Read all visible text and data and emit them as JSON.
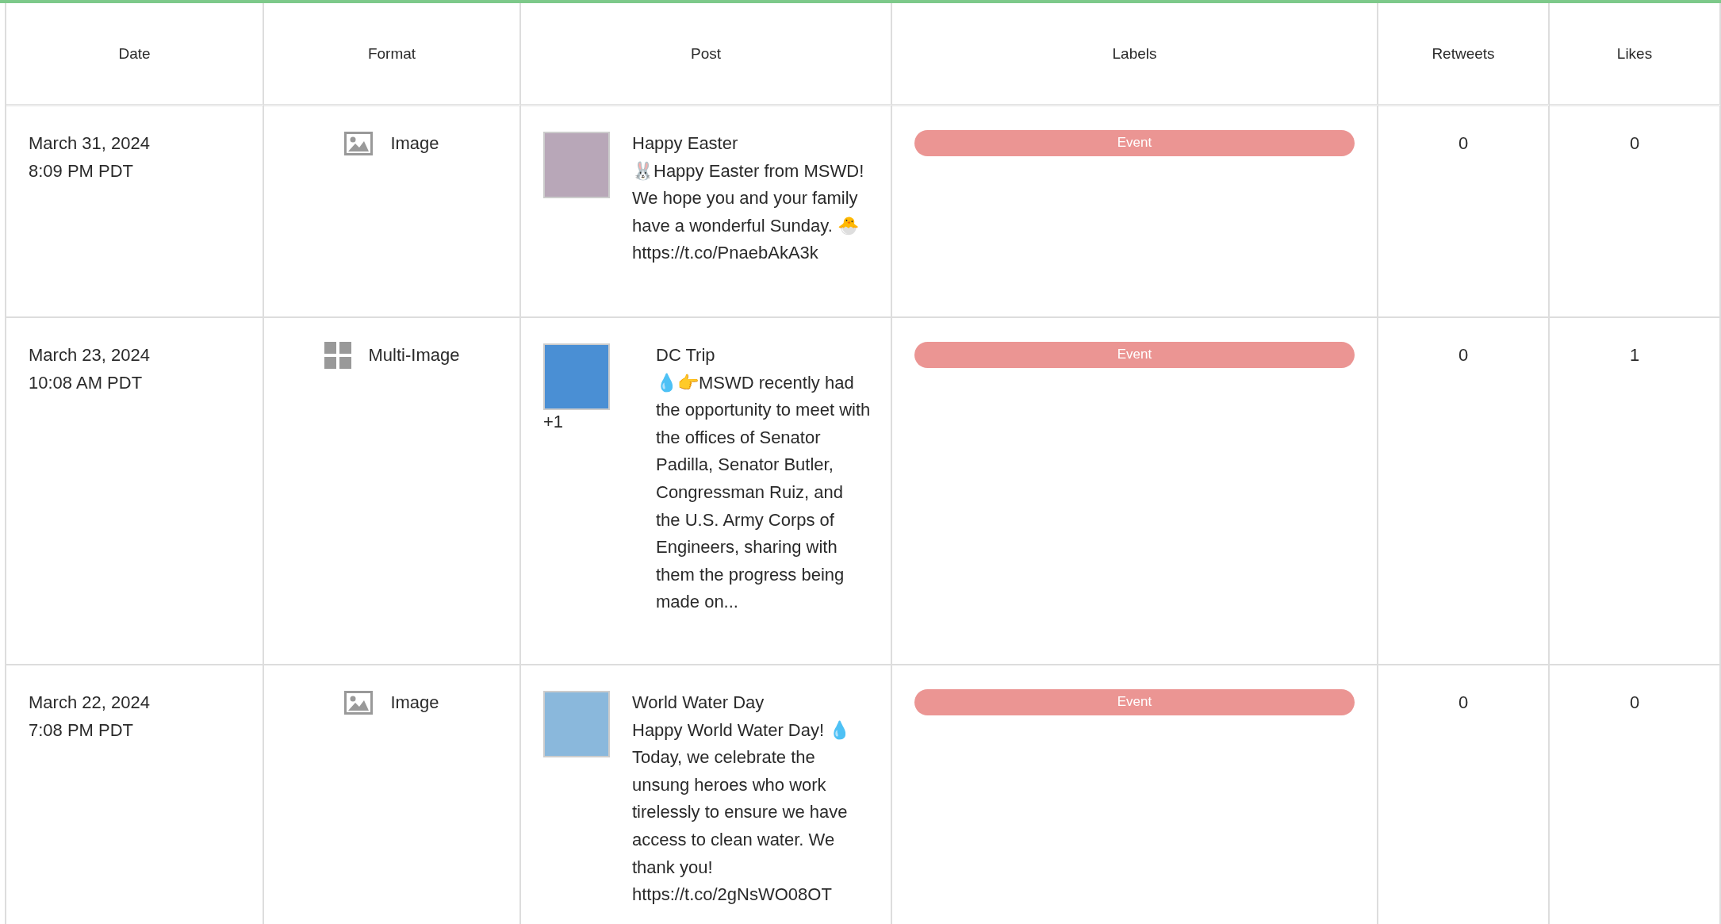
{
  "columns": [
    "Date",
    "Format",
    "Post",
    "Labels",
    "Retweets",
    "Likes"
  ],
  "rows": [
    {
      "date": "March 31, 2024",
      "time": "8:09 PM PDT",
      "format": {
        "kind": "image",
        "label": "Image"
      },
      "post": {
        "title": "Happy Easter",
        "body": "🐰Happy Easter from MSWD! We hope you and your family have a wonderful Sunday. 🐣 https://t.co/PnaebAkA3k"
      },
      "labels": [
        {
          "text": "Event",
          "color": "#eb9593"
        }
      ],
      "retweets": "0",
      "likes": "0"
    },
    {
      "date": "March 23, 2024",
      "time": "10:08 AM PDT",
      "format": {
        "kind": "multi",
        "label": "Multi-Image"
      },
      "post": {
        "title": "DC Trip",
        "body": "💧👉MSWD recently had the opportunity to meet with the offices of Senator Padilla, Senator Butler, Congressman Ruiz, and the U.S. Army Corps of Engineers, sharing with them the progress being made on...",
        "extra": "+1"
      },
      "labels": [
        {
          "text": "Event",
          "color": "#eb9593"
        }
      ],
      "retweets": "0",
      "likes": "1"
    },
    {
      "date": "March 22, 2024",
      "time": "7:08 PM PDT",
      "format": {
        "kind": "image",
        "label": "Image"
      },
      "post": {
        "title": "World Water Day",
        "body": "Happy World Water Day! 💧 Today, we celebrate the unsung heroes who work tirelessly to ensure we have access to clean water. We thank you! https://t.co/2gNsWO08OT"
      },
      "labels": [
        {
          "text": "Event",
          "color": "#eb9593"
        }
      ],
      "retweets": "0",
      "likes": "0"
    }
  ]
}
